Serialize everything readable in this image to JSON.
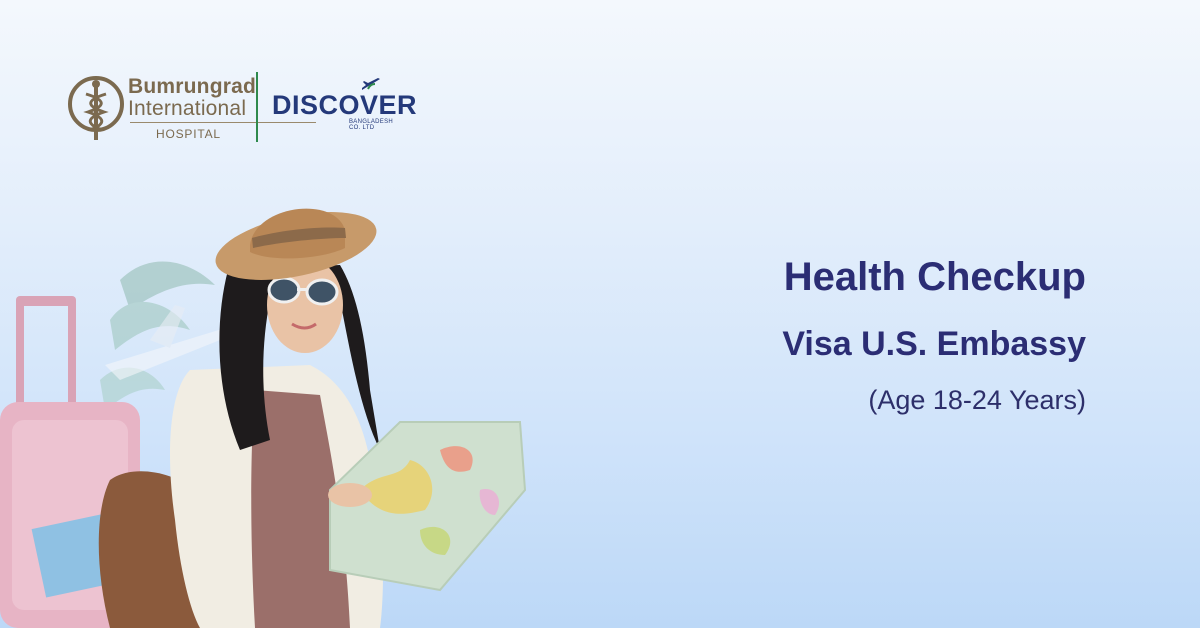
{
  "brand": {
    "bumrungrad": {
      "line1": "Bumrungrad",
      "line2": "International",
      "line3": "HOSPITAL"
    },
    "discover": {
      "word": "DISCOVER",
      "sub": "BANGLADESH CO. LTD"
    }
  },
  "headline": {
    "title": "Health Checkup",
    "subtitle": "Visa U.S. Embassy",
    "age_note": "(Age 18-24 Years)"
  },
  "colors": {
    "headline": "#2b2d74",
    "bumrungrad_gold": "#7b6a4f",
    "discover_blue": "#24397a",
    "divider_green": "#2f8a4d"
  },
  "icons": [
    "caduceus-icon",
    "airplane-icon"
  ]
}
